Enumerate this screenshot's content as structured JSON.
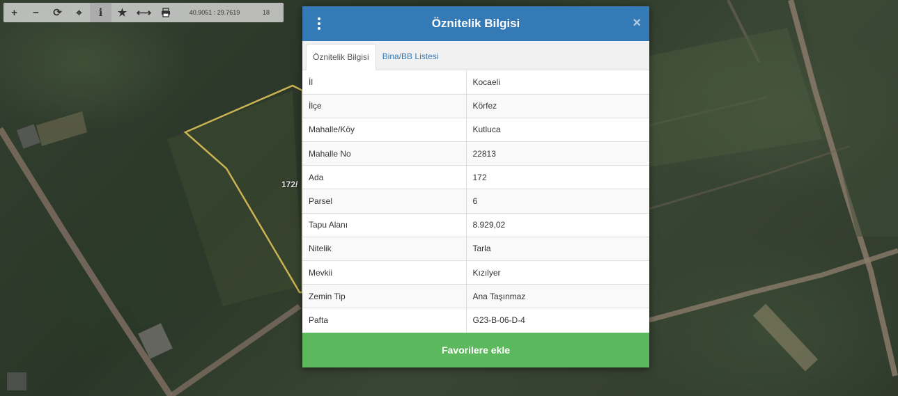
{
  "toolbar": {
    "coordinates": "40.9051 : 29.7619",
    "zoom_level": "18",
    "tools": [
      {
        "icon": "zoom-in-icon",
        "glyph": "+"
      },
      {
        "icon": "zoom-out-icon",
        "glyph": "−"
      },
      {
        "icon": "refresh-icon",
        "glyph": "⟳"
      },
      {
        "icon": "locate-icon",
        "glyph": "⌖"
      },
      {
        "icon": "info-icon",
        "glyph": "i"
      },
      {
        "icon": "star-icon",
        "glyph": "★"
      },
      {
        "icon": "measure-icon",
        "glyph": "⟷"
      },
      {
        "icon": "print-icon",
        "glyph": "🖶"
      }
    ]
  },
  "map": {
    "parcel_label": "172/"
  },
  "dialog": {
    "title": "Öznitelik Bilgisi",
    "close_glyph": "×",
    "tabs": [
      {
        "label": "Öznitelik Bilgisi",
        "active": true
      },
      {
        "label": "Bina/BB Listesi",
        "active": false
      }
    ],
    "rows": [
      {
        "key": "İl",
        "value": "Kocaeli"
      },
      {
        "key": "İlçe",
        "value": "Körfez"
      },
      {
        "key": "Mahalle/Köy",
        "value": "Kutluca"
      },
      {
        "key": "Mahalle No",
        "value": "22813"
      },
      {
        "key": "Ada",
        "value": "172"
      },
      {
        "key": "Parsel",
        "value": "6"
      },
      {
        "key": "Tapu Alanı",
        "value": "8.929,02"
      },
      {
        "key": "Nitelik",
        "value": "Tarla"
      },
      {
        "key": "Mevkii",
        "value": "Kızılyer"
      },
      {
        "key": "Zemin Tip",
        "value": "Ana Taşınmaz"
      },
      {
        "key": "Pafta",
        "value": "G23-B-06-D-4"
      }
    ],
    "favorite_button": "Favorilere ekle"
  },
  "colors": {
    "header": "#337ab7",
    "button": "#5cb85c",
    "parcel_outline": "#c9b352",
    "road": "#8a7a6a"
  }
}
